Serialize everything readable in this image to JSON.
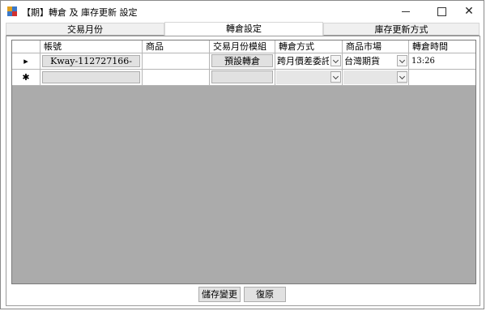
{
  "window": {
    "title": "【期】轉倉 及 庫存更新 設定",
    "minimize_glyph": "",
    "maximize_glyph": "",
    "close_glyph": "✕"
  },
  "tabs": [
    {
      "label": "交易月份",
      "active": false
    },
    {
      "label": "轉倉設定",
      "active": true
    },
    {
      "label": "庫存更新方式",
      "active": false
    }
  ],
  "grid": {
    "columns": [
      "帳號",
      "商品",
      "交易月份模組",
      "轉倉方式",
      "商品市場",
      "轉倉時間"
    ],
    "rows": [
      {
        "row_marker": "▸",
        "account": "Kway-112727166-",
        "product": "",
        "month_module_button": "預設轉倉",
        "rollover_method": "跨月價差委託",
        "market": "台灣期貨",
        "rollover_time": "13:26"
      },
      {
        "row_marker": "✱",
        "account": "",
        "product": "",
        "month_module_button": "",
        "rollover_method": "",
        "market": "",
        "rollover_time": ""
      }
    ],
    "background_color": "#ababab"
  },
  "buttons": {
    "save": "儲存變更",
    "revert": "復原"
  }
}
